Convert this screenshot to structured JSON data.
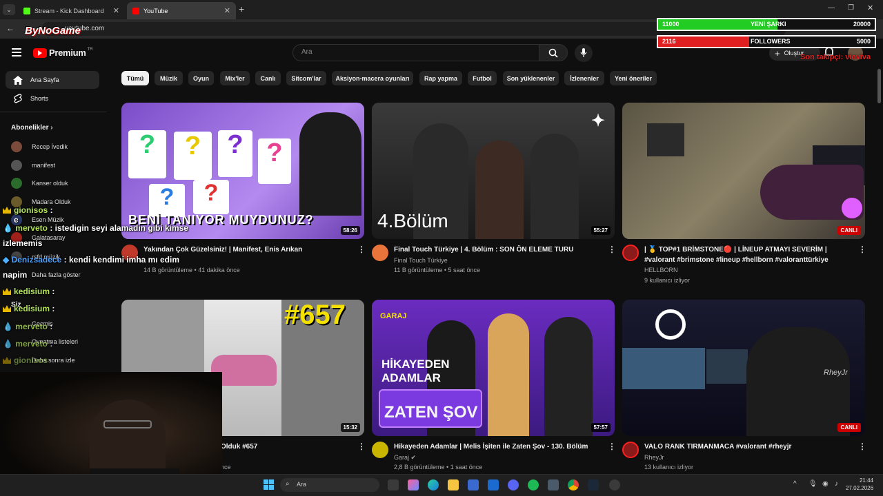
{
  "browser": {
    "tabs": [
      {
        "label": "Stream - Kick Dashboard",
        "color": "#53fc18"
      },
      {
        "label": "YouTube",
        "color": "#ff0000"
      }
    ],
    "address": "youtube.com"
  },
  "youtube": {
    "logo": "Premium",
    "logo_sup": "TR",
    "search_placeholder": "Ara",
    "create_label": "Oluştur"
  },
  "sidebar": {
    "items": [
      {
        "label": "Ana Sayfa",
        "icon": "home-icon"
      },
      {
        "label": "Shorts",
        "icon": "shorts-icon"
      }
    ],
    "subs_heading": "Abonelikler",
    "subs": [
      {
        "label": "Recep İvedik",
        "color": "#7a4a3a"
      },
      {
        "label": "manifest",
        "color": "#555"
      },
      {
        "label": "Kanser olduk",
        "color": "#2b6b2b"
      },
      {
        "label": "Madara Olduk",
        "color": "#6b5b2b"
      },
      {
        "label": "Esen Müzik",
        "color": "#2b3b6b"
      },
      {
        "label": "Galatasaray",
        "color": "#a0201a"
      },
      {
        "label": "rsfd müzik",
        "color": "#444"
      }
    ],
    "show_more": "Daha fazla göster",
    "you_heading": "Siz",
    "you_items": [
      "Geçmiş",
      "Oynatma listeleri",
      "Daha sonra izle"
    ]
  },
  "chips": [
    "Tümü",
    "Müzik",
    "Oyun",
    "Mix'ler",
    "Canlı",
    "Sitcom'lar",
    "Aksiyon-macera oyunları",
    "Rap yapma",
    "Futbol",
    "Son yüklenenler",
    "İzlenenler",
    "Yeni öneriler"
  ],
  "videos": [
    {
      "title": "Yakından Çok Güzelsiniz! | Manifest, Enis Arıkan",
      "channel": "",
      "meta": "14 B görüntüleme • 41 dakika önce",
      "badge": "58:26",
      "live": false,
      "thumb_text": "BENİ TANIYOR MUYDUNUZ?",
      "av": "#c0392b"
    },
    {
      "title": "Final Touch Türkiye | 4. Bölüm : SON ÖN ELEME TURU",
      "channel": "Final Touch Türkiye",
      "meta": "11 B görüntüleme • 5 saat önce",
      "badge": "55:27",
      "live": false,
      "thumb_text": "4.Bölüm",
      "av": "#e8743b"
    },
    {
      "title": "| 🥇 TOP#1 BRİMSTONE🔴 | LİNEUP ATMAYI SEVERİM | #valorant #brimstone #lineup #hellborn #valoranttürkiye",
      "channel": "HELLBORN",
      "meta": "9 kullanıcı izliyor",
      "badge": "CANLI",
      "live": true,
      "thumb_text": "",
      "av": "#8b1a1a"
    },
    {
      "title": "Olduk #657",
      "channel": "",
      "meta": "nce",
      "badge": "15:32",
      "live": false,
      "thumb_text": "#657",
      "av": "#333"
    },
    {
      "title": "Hikayeden Adamlar | Melis İşiten ile Zaten Şov - 130. Bölüm",
      "channel": "Garaj",
      "meta": "2,8 B görüntüleme • 1 saat önce",
      "badge": "57:57",
      "live": false,
      "thumb_text": "HİKAYEDEN ADAMLAR",
      "thumb_text2": "ZATEN ŞOV",
      "thumb_label": "GARAJ",
      "av": "#c9b400"
    },
    {
      "title": "VALO RANK TIRMANMACA #valorant #rheyjr",
      "channel": "RheyJr",
      "meta": "13 kullanıcı izliyor",
      "badge": "CANLI",
      "live": true,
      "thumb_text": "RheyJr",
      "av": "#8b1a1a"
    }
  ],
  "overlay": {
    "streamer_logo": "ByNoGame",
    "stats": [
      {
        "left": "11000",
        "label": "YENİ ŞARKI",
        "right": "20000",
        "fraction": 0.55,
        "color": "#22cc22"
      },
      {
        "left": "2116",
        "label": "FOLLOWERS",
        "right": "5000",
        "fraction": 0.42,
        "color": "#e02020"
      }
    ],
    "last_follower": "Son takipçi: vieviva",
    "chat": [
      {
        "user": "gionisos",
        "msg": ""
      },
      {
        "user": "",
        "msg": "e"
      },
      {
        "user": "merveto",
        "msg": "istedigin seyi alamadin gibi kimse"
      },
      {
        "user": "",
        "msg": "izlememis"
      },
      {
        "user": "Denizsadece",
        "msg": "kendi kendimi imha mı edim"
      },
      {
        "user": "",
        "msg": "napim"
      },
      {
        "user": "kedisium",
        "msg": ""
      },
      {
        "user": "kedisium",
        "msg": ""
      },
      {
        "user": "merveto",
        "msg": ""
      },
      {
        "user": "merveto",
        "msg": ""
      },
      {
        "user": "gionisos",
        "msg": ""
      }
    ]
  },
  "taskbar": {
    "search": "Ara",
    "time": "21:44",
    "date": "27.02.2026"
  }
}
